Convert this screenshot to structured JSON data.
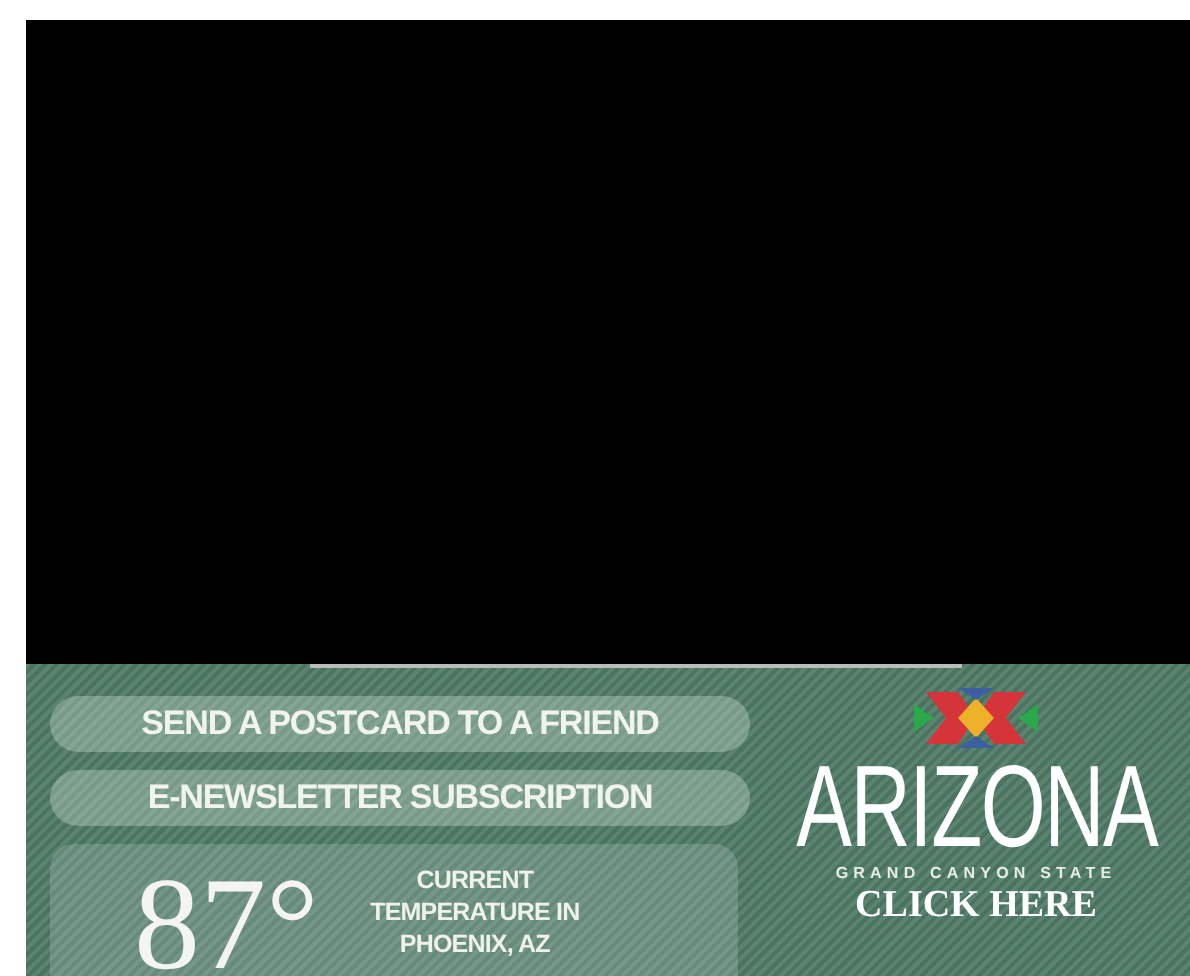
{
  "links": [
    {
      "label": "SEND A POSTCARD TO A FRIEND"
    },
    {
      "label": "E-NEWSLETTER SUBSCRIPTION"
    }
  ],
  "weather": {
    "temperature": "87°",
    "caption": "CURRENT TEMPERATURE IN PHOENIX, AZ"
  },
  "promo": {
    "logo_text": "ARIZONA",
    "tagline": "GRAND CANYON STATE",
    "cta": "CLICK HERE"
  }
}
